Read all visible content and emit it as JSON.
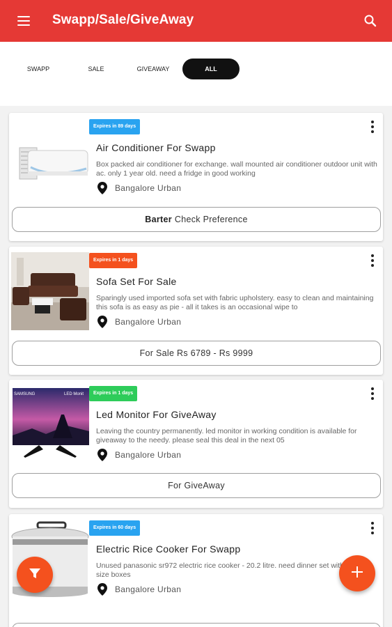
{
  "appbar": {
    "title": "Swapp/Sale/GiveAway",
    "menu_icon": "hamburger-menu-icon",
    "search_icon": "search-icon",
    "color": "#e53935"
  },
  "tabs": [
    {
      "label": "SWAPP",
      "active": false
    },
    {
      "label": "SALE",
      "active": false
    },
    {
      "label": "GIVEAWAY",
      "active": false
    },
    {
      "label": "ALL",
      "active": true
    }
  ],
  "listings": [
    {
      "badge": "Expires in 89 days",
      "badge_color": "#29a3f0",
      "title": "Air Conditioner For Swapp",
      "description": "Box packed air conditioner for exchange. wall mounted air conditioner outdoor unit with ac. only 1 year old. need a fridge in good working",
      "location": "Bangalore Urban",
      "action_bold": "Barter",
      "action": "Check Preference"
    },
    {
      "badge": "Expires in 1 days",
      "badge_color": "#f4511e",
      "title": "Sofa Set For Sale",
      "description": "Sparingly used imported sofa set with fabric upholstery. easy to clean and maintaining this sofa is as easy as pie - all it takes is an occasional wipe to",
      "location": "Bangalore Urban",
      "action_bold": "",
      "action": "For Sale Rs 6789 - Rs 9999"
    },
    {
      "badge": "Expires in 1 days",
      "badge_color": "#2ecc5a",
      "title": "Led Monitor For GiveAway",
      "description": "Leaving the country permanently. led monitor in working condition is available for giveaway to the needy. please seal this deal in the next 05",
      "location": "Bangalore Urban",
      "action_bold": "",
      "action": "For GiveAway",
      "image_text": [
        "SAMSUNG",
        "LED Monit"
      ]
    },
    {
      "badge": "Expires in 60 days",
      "badge_color": "#29a3f0",
      "title": "Electric Rice Cooker For Swapp",
      "description": "Unused panasonic sr972 electric rice cooker - 20.2 litre. need dinner set with different size boxes",
      "location": "Bangalore Urban"
    }
  ],
  "fabs": {
    "filter_icon": "filter-icon",
    "add_icon": "plus-icon",
    "color": "#f4511e"
  }
}
